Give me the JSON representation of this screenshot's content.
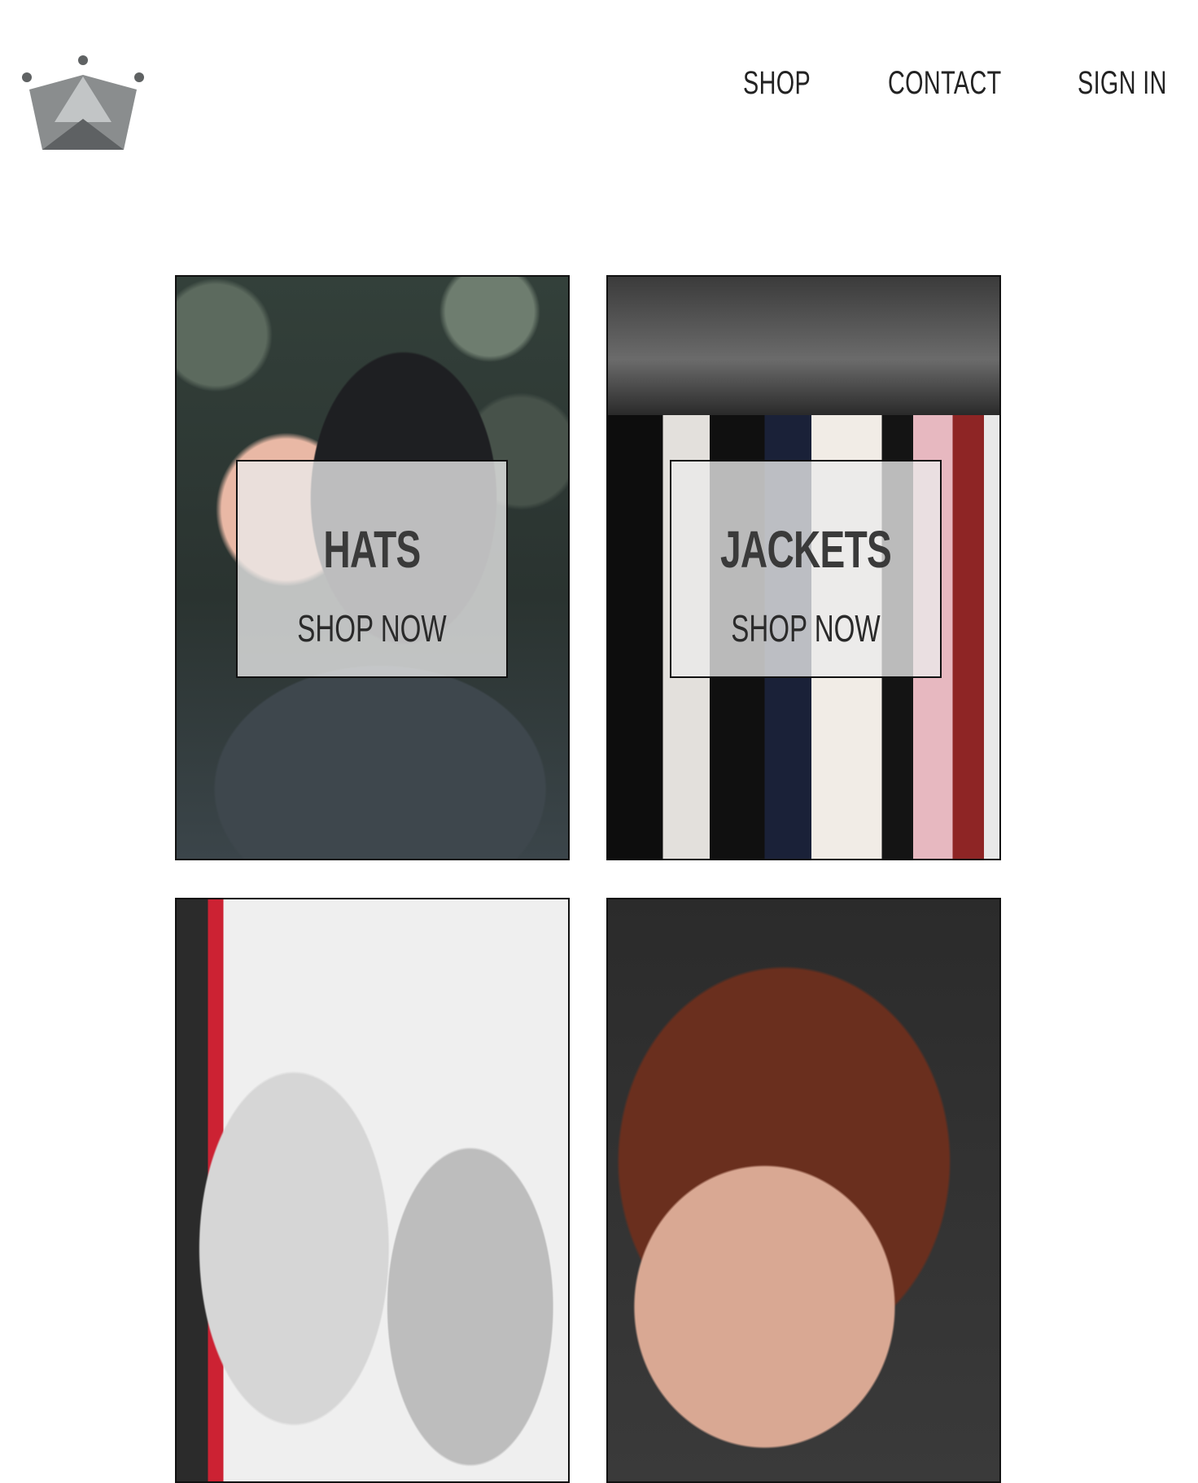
{
  "header": {
    "logo_name": "crown-logo-icon",
    "nav": [
      {
        "label": "SHOP"
      },
      {
        "label": "CONTACT"
      },
      {
        "label": "SIGN IN"
      }
    ]
  },
  "categories": [
    {
      "title": "HATS",
      "cta": "SHOP NOW",
      "photo": "cap-back-of-head"
    },
    {
      "title": "JACKETS",
      "cta": "SHOP NOW",
      "photo": "clothing-rack"
    },
    {
      "title": "",
      "cta": "",
      "photo": "sneakers-closeup"
    },
    {
      "title": "",
      "cta": "",
      "photo": "woman-portrait"
    }
  ],
  "colors": {
    "text": "#222222",
    "overlay": "#ebebeb",
    "border": "#111111",
    "logo": "#7a7c7d"
  }
}
